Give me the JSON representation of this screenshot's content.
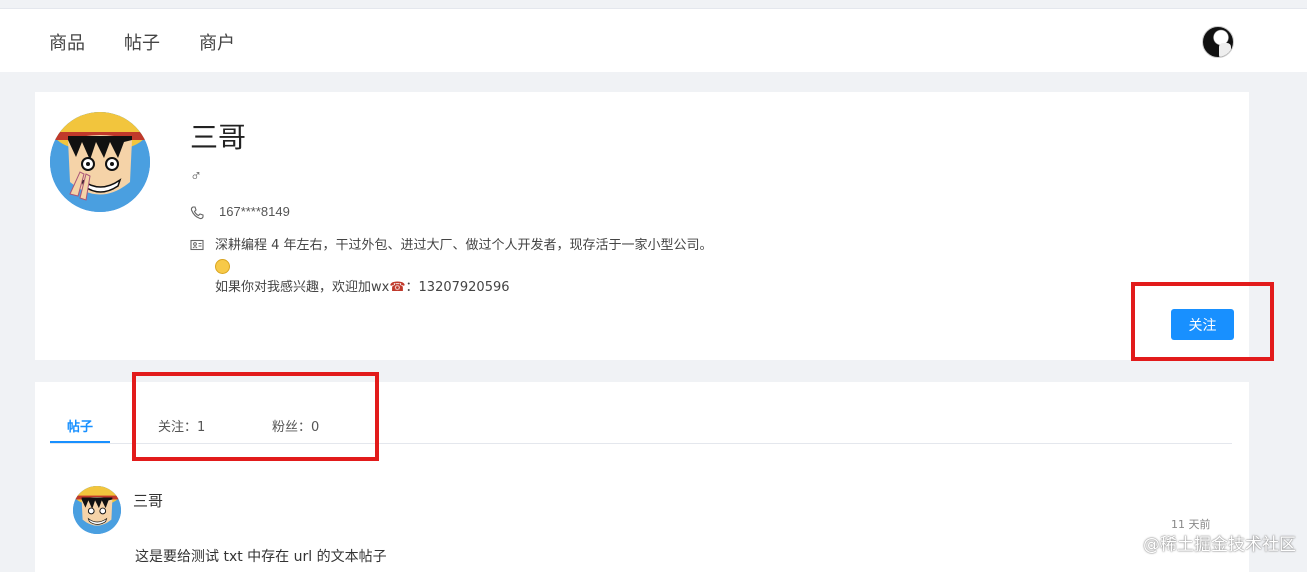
{
  "nav": {
    "items": [
      "商品",
      "帖子",
      "商户"
    ]
  },
  "profile": {
    "name": "三哥",
    "gender_symbol": "♂",
    "phone": "167****8149",
    "bio_line1": "深耕编程 4 年左右，干过外包、进过大厂、做过个人开发者，现存活于一家小型公司。",
    "bio_line3_prefix": "如果你对我感兴趣，欢迎加wx",
    "bio_line3_suffix": "：13207920596",
    "follow_label": "关注"
  },
  "tabs": {
    "posts": "帖子",
    "following": "关注：1",
    "followers": "粉丝：0"
  },
  "post": {
    "author": "三哥",
    "time": "11 天前",
    "text": "这是要给测试 txt 中存在 url 的文本帖子"
  },
  "watermark": "@稀土掘金技术社区",
  "colors": {
    "accent": "#1890ff",
    "highlight_box": "#e21b1b"
  }
}
